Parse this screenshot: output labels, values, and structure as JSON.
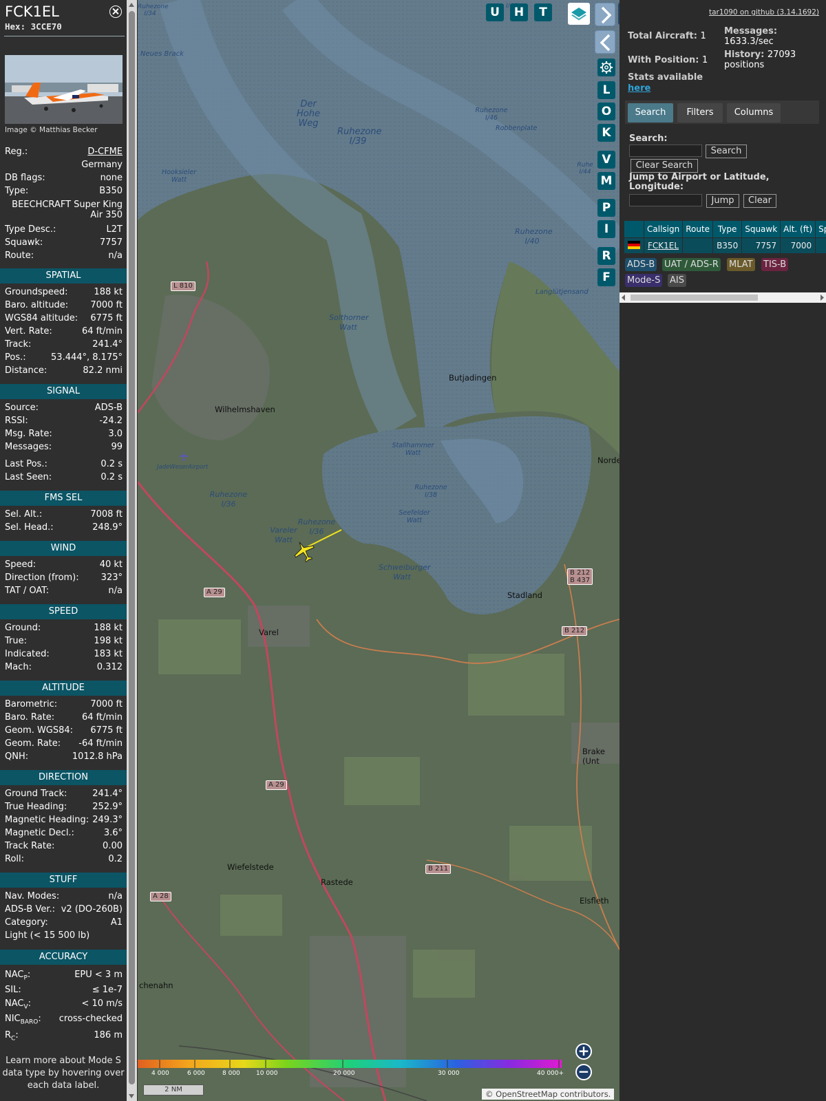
{
  "aircraft": {
    "callsign": "FCK1EL",
    "hex_label": "Hex: 3CCE70",
    "image_credit": "Image © Matthias Becker"
  },
  "details": [
    {
      "k": "Reg.:",
      "v": "D-CFME"
    },
    {
      "k": "",
      "v": "Germany"
    },
    {
      "k": "DB flags:",
      "v": "none"
    },
    {
      "k": "Type:",
      "v": "B350"
    },
    {
      "k": "",
      "v": "BEECHCRAFT Super King Air 350"
    },
    {
      "k": "Type Desc.:",
      "v": "L2T"
    },
    {
      "k": "Squawk:",
      "v": "7757"
    },
    {
      "k": "Route:",
      "v": "n/a"
    }
  ],
  "sections": {
    "spatial": "SPATIAL",
    "signal": "SIGNAL",
    "fms": "FMS SEL",
    "wind": "WIND",
    "speed": "SPEED",
    "altitude": "ALTITUDE",
    "direction": "DIRECTION",
    "stuff": "STUFF",
    "accuracy": "ACCURACY"
  },
  "spatial": [
    {
      "k": "Groundspeed:",
      "v": "188 kt"
    },
    {
      "k": "Baro. altitude:",
      "v": "7000 ft"
    },
    {
      "k": "WGS84 altitude:",
      "v": "6775 ft"
    },
    {
      "k": "Vert. Rate:",
      "v": "64 ft/min"
    },
    {
      "k": "Track:",
      "v": "241.4°"
    },
    {
      "k": "Pos.:",
      "v": "53.444°, 8.175°"
    },
    {
      "k": "Distance:",
      "v": "82.2 nmi"
    }
  ],
  "signal": [
    {
      "k": "Source:",
      "v": "ADS-B"
    },
    {
      "k": "RSSI:",
      "v": "-24.2"
    },
    {
      "k": "Msg. Rate:",
      "v": "3.0"
    },
    {
      "k": "Messages:",
      "v": "99"
    },
    {
      "k": "Last Pos.:",
      "v": "0.2 s"
    },
    {
      "k": "Last Seen:",
      "v": "0.2 s"
    }
  ],
  "fms": [
    {
      "k": "Sel. Alt.:",
      "v": "7008 ft"
    },
    {
      "k": "Sel. Head.:",
      "v": "248.9°"
    }
  ],
  "wind": [
    {
      "k": "Speed:",
      "v": "40 kt"
    },
    {
      "k": "Direction (from):",
      "v": "323°"
    },
    {
      "k": "TAT / OAT:",
      "v": "n/a"
    }
  ],
  "speed": [
    {
      "k": "Ground:",
      "v": "188 kt"
    },
    {
      "k": "True:",
      "v": "198 kt"
    },
    {
      "k": "Indicated:",
      "v": "183 kt"
    },
    {
      "k": "Mach:",
      "v": "0.312"
    }
  ],
  "altitude": [
    {
      "k": "Barometric:",
      "v": "7000 ft"
    },
    {
      "k": "Baro. Rate:",
      "v": "64 ft/min"
    },
    {
      "k": "Geom. WGS84:",
      "v": "6775 ft"
    },
    {
      "k": "Geom. Rate:",
      "v": "-64 ft/min"
    },
    {
      "k": "QNH:",
      "v": "1012.8 hPa"
    }
  ],
  "direction": [
    {
      "k": "Ground Track:",
      "v": "241.4°"
    },
    {
      "k": "True Heading:",
      "v": "252.9°"
    },
    {
      "k": "Magnetic Heading:",
      "v": "249.3°"
    },
    {
      "k": "Magnetic Decl.:",
      "v": "3.6°"
    },
    {
      "k": "Track Rate:",
      "v": "0.00"
    },
    {
      "k": "Roll:",
      "v": "0.2"
    }
  ],
  "stuff": [
    {
      "k": "Nav. Modes:",
      "v": "n/a"
    },
    {
      "k": "ADS-B Ver.:",
      "v": "v2 (DO-260B)"
    },
    {
      "k": "Category:",
      "v": "A1"
    },
    {
      "k": "Light (< 15 500 lb)",
      "v": ""
    }
  ],
  "accuracy": [
    {
      "k": "NAC",
      "sub": "P",
      "v": "EPU < 3 m"
    },
    {
      "k": "SIL:",
      "sub": "",
      "v": "≤ 1e-7"
    },
    {
      "k": "NAC",
      "sub": "V",
      "v": "< 10 m/s"
    },
    {
      "k": "NIC",
      "sub": "BARO",
      "v": "cross-checked"
    },
    {
      "k": "R",
      "sub": "C",
      "v": "186 m"
    }
  ],
  "learn_more": "Learn more about Mode S data type by hovering over each data label.",
  "map": {
    "buttons": [
      "U",
      "H",
      "T",
      "L",
      "O",
      "K",
      "V",
      "M",
      "P",
      "I",
      "R",
      "F"
    ],
    "legend_labels": [
      "4 000",
      "6 000",
      "8 000",
      "10 000",
      "20 000",
      "30 000",
      "40 000+"
    ],
    "scale_label": "2 NM",
    "attribution_prefix": "© OpenStreetMap",
    "attribution_suffix": "contributors.",
    "place_labels": {
      "neues_brack": "Neues Brack",
      "hohe_weg": "Der Hohe Weg",
      "ruhezone_i39": "Ruhezone I/39",
      "ruhezone_i46": "Ruhezone I/46",
      "robbenplate": "Robbenplate",
      "hooksieler": "Hooksieler Watt",
      "ruhezone_i40": "Ruhezone I/40",
      "langlutjensand": "Langlütjensand",
      "solthorner": "Solthorner Watt",
      "butjadingen": "Butjadingen",
      "wilhelmshaven": "Wilhelmshaven",
      "jadeweser": "JadeWeserAirport",
      "stallhammer": "Stallhammer Watt",
      "nordenham": "Norde",
      "ruhezone_i36a": "Ruhezone I/36",
      "ruhezone_i38": "Ruhezone I/38",
      "seefelder": "Seefelder Watt",
      "ruhezone_i36b": "Ruhezone I/36",
      "vareler": "Vareler Watt",
      "schweiburger": "Schweiburger Watt",
      "stadland": "Stadland",
      "varel": "Varel",
      "brake": "Brake (Unt",
      "wiefelstede": "Wiefelstede",
      "rastede": "Rastede",
      "elsfleth": "Elsfleth",
      "bad_zwischenahn": "chenahn",
      "ruhezone_i34": "Ruhezone I/34",
      "ruhezone_i46b": "I/46",
      "ruhezone_i44": "Ruhe I/44"
    },
    "road_labels": {
      "l810": "L 810",
      "a29a": "A 29",
      "a29b": "A 29",
      "b212a": "B 212",
      "b437": "B 437",
      "b212b": "B 212",
      "b211": "B 211",
      "a28": "A 28"
    }
  },
  "right": {
    "github_link": "tar1090 on github (3.14.1692)",
    "total_aircraft_label": "Total Aircraft:",
    "total_aircraft": "1",
    "with_position_label": "With Position:",
    "with_position": "1",
    "messages_label": "Messages:",
    "messages_rate": "1633.3/sec",
    "history_label": "History:",
    "history_count": "27093",
    "history_unit": "positions",
    "stats_available": "Stats available",
    "here_link": "here",
    "tabs": [
      "Search",
      "Filters",
      "Columns"
    ],
    "search_label": "Search:",
    "search_button": "Search",
    "clear_search_button": "Clear Search",
    "jump_label": "Jump to Airport or Latitude, Longitude:",
    "jump_button": "Jump",
    "clear_button": "Clear",
    "columns": [
      "",
      "Callsign",
      "Route",
      "Type",
      "Squawk",
      "Alt. (ft)",
      "Spd."
    ],
    "rows": [
      {
        "callsign": "FCK1EL",
        "route": "",
        "type": "B350",
        "squawk": "7757",
        "alt": "7000",
        "spd": ""
      }
    ],
    "sources": [
      {
        "label": "ADS-B",
        "color": "#1d4e6b"
      },
      {
        "label": "UAT / ADS-R",
        "color": "#2f5a3a"
      },
      {
        "label": "MLAT",
        "color": "#6b5a2a"
      },
      {
        "label": "TIS-B",
        "color": "#6b2340"
      },
      {
        "label": "Mode-S",
        "color": "#3a2f6b"
      },
      {
        "label": "AIS",
        "color": "#4a4a4a"
      }
    ]
  },
  "colors": {
    "section_header": "#0b5565",
    "map_button": "#00596b",
    "aircraft_marker": "#f3e41e",
    "link": "#2fa3d8"
  }
}
